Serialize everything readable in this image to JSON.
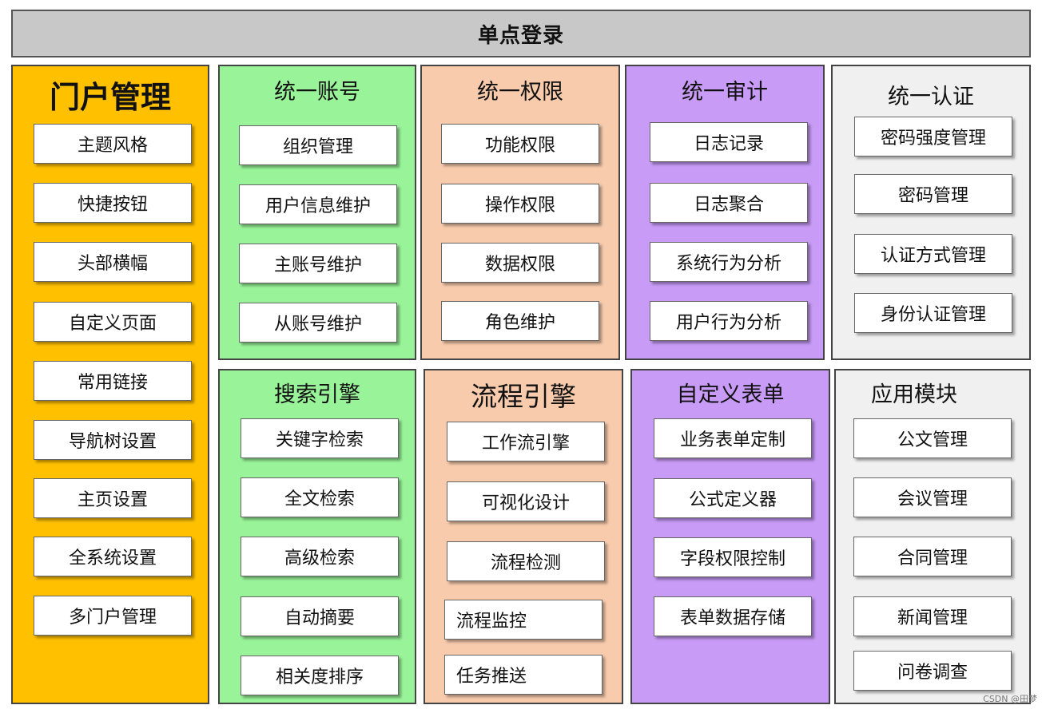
{
  "header": {
    "title": "单点登录"
  },
  "colors": {
    "portal": "#ffc000",
    "account": "#99f499",
    "permission": "#f8cbad",
    "audit": "#c89bf7",
    "auth": "#f0f0f0"
  },
  "panels": {
    "portal": {
      "title": "门户管理",
      "items": [
        "主题风格",
        "快捷按钮",
        "头部横幅",
        "自定义页面",
        "常用链接",
        "导航树设置",
        "主页设置",
        "全系统设置",
        "多门户管理"
      ]
    },
    "account": {
      "title": "统一账号",
      "items": [
        "组织管理",
        "用户信息维护",
        "主账号维护",
        "从账号维护"
      ]
    },
    "perm": {
      "title": "统一权限",
      "items": [
        "功能权限",
        "操作权限",
        "数据权限",
        "角色维护"
      ]
    },
    "audit": {
      "title": "统一审计",
      "items": [
        "日志记录",
        "日志聚合",
        "系统行为分析",
        "用户行为分析"
      ]
    },
    "auth": {
      "title": "统一认证",
      "items": [
        "密码强度管理",
        "密码管理",
        "认证方式管理",
        "身份认证管理"
      ]
    },
    "search": {
      "title": "搜索引擎",
      "items": [
        "关键字检索",
        "全文检索",
        "高级检索",
        "自动摘要",
        "相关度排序"
      ]
    },
    "workflow": {
      "title": "流程引擎",
      "items": [
        "工作流引擎",
        "可视化设计",
        "流程检测",
        "流程监控",
        "任务推送"
      ]
    },
    "forms": {
      "title": "自定义表单",
      "items": [
        "业务表单定制",
        "公式定义器",
        "字段权限控制",
        "表单数据存储"
      ]
    },
    "apps": {
      "title": "应用模块",
      "items": [
        "公文管理",
        "会议管理",
        "合同管理",
        "新闻管理",
        "问卷调查"
      ]
    }
  },
  "watermark": "CSDN @田梦"
}
